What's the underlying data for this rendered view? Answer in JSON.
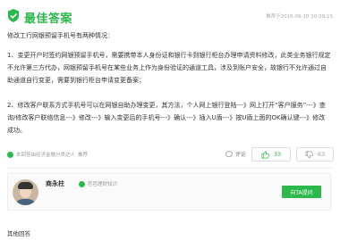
{
  "header": {
    "title": "最佳答案",
    "timestamp": "推荐于2016-09-10 10:09:15",
    "accent": "#2db84d"
  },
  "content": {
    "intro": "修改工行网银预留手机号有两种情况：",
    "paragraph1": "1、变更开户时签约网银预留手机号，需要携带本人身份证和银行卡到银行柜台办理申请资料修改，此类业务银行规定不允许第三方代办，网银预留手机号在某些业务上作为身份验证的通道工具，涉及到账户安全，故银行不允许通过自助通道自行变更，需要到银行柜台申请变更备案；",
    "paragraph2": "2、修改客户联系方式手机号可以在网银自助办理变更，其方法，个人网上银行登陆---》网上打开“客户服务”---》查询/修改客户联络信息---》修改---》输入变更后的手机号---》确认---》插入U盾---》按U盾上面的OK确认键---》修改成功。"
  },
  "footer": {
    "source_text": "本回答由经济金融分类达人",
    "source_link": "推荐",
    "comment_label": "评论",
    "comment_icon": "comment-icon",
    "likes": "33",
    "dislikes": "63",
    "like_icon": "thumbs-up-icon",
    "dislike_icon": "thumbs-down-icon"
  },
  "user": {
    "name": "商永柱",
    "level_text": "芭芭理财知识",
    "stats": "",
    "follow_label": "向TA提问"
  },
  "bottom": {
    "label": "其他回答"
  }
}
